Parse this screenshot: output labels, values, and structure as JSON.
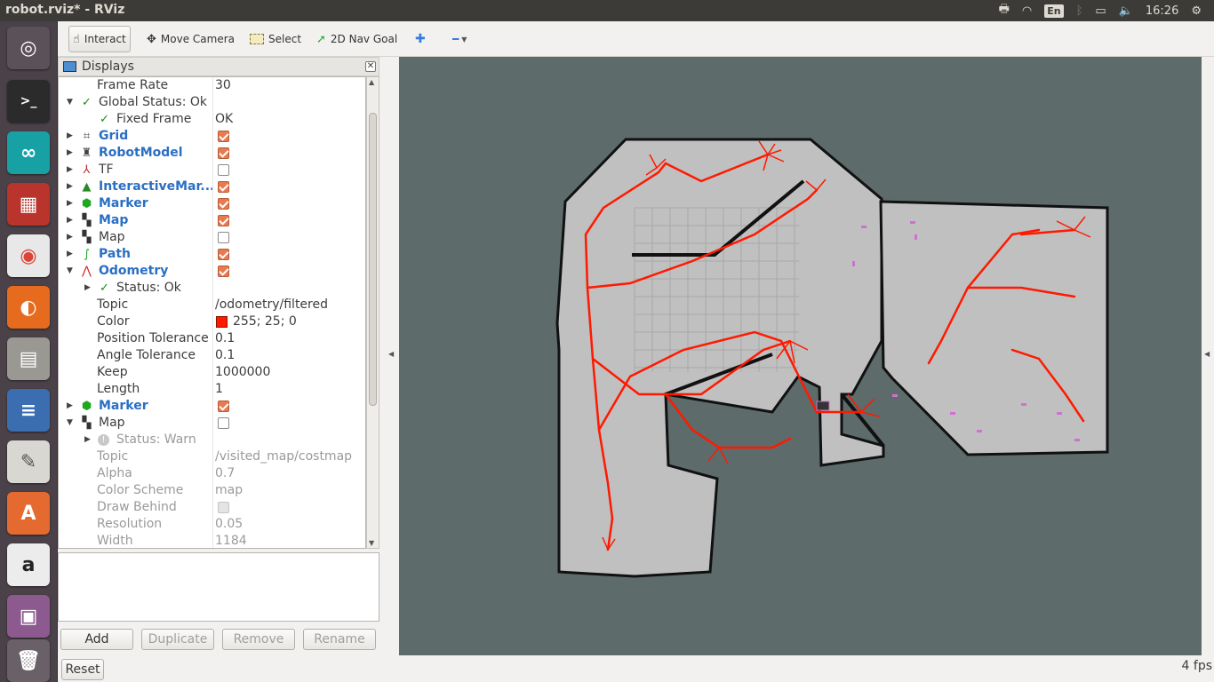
{
  "window": {
    "title": "robot.rviz* - RViz"
  },
  "tray": {
    "lang": "En",
    "time": "16:26"
  },
  "toolbar": {
    "tools": [
      {
        "label": "Interact",
        "icon": "hand-icon",
        "active": true
      },
      {
        "label": "Move Camera",
        "icon": "move-camera-icon"
      },
      {
        "label": "Select",
        "icon": "select-icon"
      },
      {
        "label": "2D Nav Goal",
        "icon": "nav-goal-arrow-icon"
      }
    ],
    "add_glyph": "✚",
    "remove_glyph": "━"
  },
  "displays": {
    "title": "Displays",
    "rows": [
      {
        "name": "Frame Rate",
        "value": "30"
      },
      {
        "name": "Global Status: Ok"
      },
      {
        "name": "Fixed Frame",
        "value": "OK"
      },
      {
        "name": "Grid"
      },
      {
        "name": "RobotModel"
      },
      {
        "name": "TF"
      },
      {
        "name": "InteractiveMar..."
      },
      {
        "name": "Marker"
      },
      {
        "name": "Map"
      },
      {
        "name": "Map"
      },
      {
        "name": "Path"
      },
      {
        "name": "Odometry"
      },
      {
        "name": "Status: Ok"
      },
      {
        "name": "Topic",
        "value": "/odometry/filtered"
      },
      {
        "name": "Color",
        "value": "255; 25; 0"
      },
      {
        "name": "Position Tolerance",
        "value": "0.1"
      },
      {
        "name": "Angle Tolerance",
        "value": "0.1"
      },
      {
        "name": "Keep",
        "value": "1000000"
      },
      {
        "name": "Length",
        "value": "1"
      },
      {
        "name": "Marker"
      },
      {
        "name": "Map"
      },
      {
        "name": "Status: Warn"
      },
      {
        "name": "Topic",
        "value": "/visited_map/costmap"
      },
      {
        "name": "Alpha",
        "value": "0.7"
      },
      {
        "name": "Color Scheme",
        "value": "map"
      },
      {
        "name": "Draw Behind"
      },
      {
        "name": "Resolution",
        "value": "0.05"
      },
      {
        "name": "Width",
        "value": "1184"
      }
    ],
    "buttons": {
      "add": "Add",
      "duplicate": "Duplicate",
      "remove": "Remove",
      "rename": "Rename"
    }
  },
  "colors": {
    "odometry": "#ff1900",
    "map_free": "#c0c0c0",
    "background": "#5d6b6b"
  },
  "status": {
    "reset": "Reset",
    "fps": "4 fps"
  }
}
